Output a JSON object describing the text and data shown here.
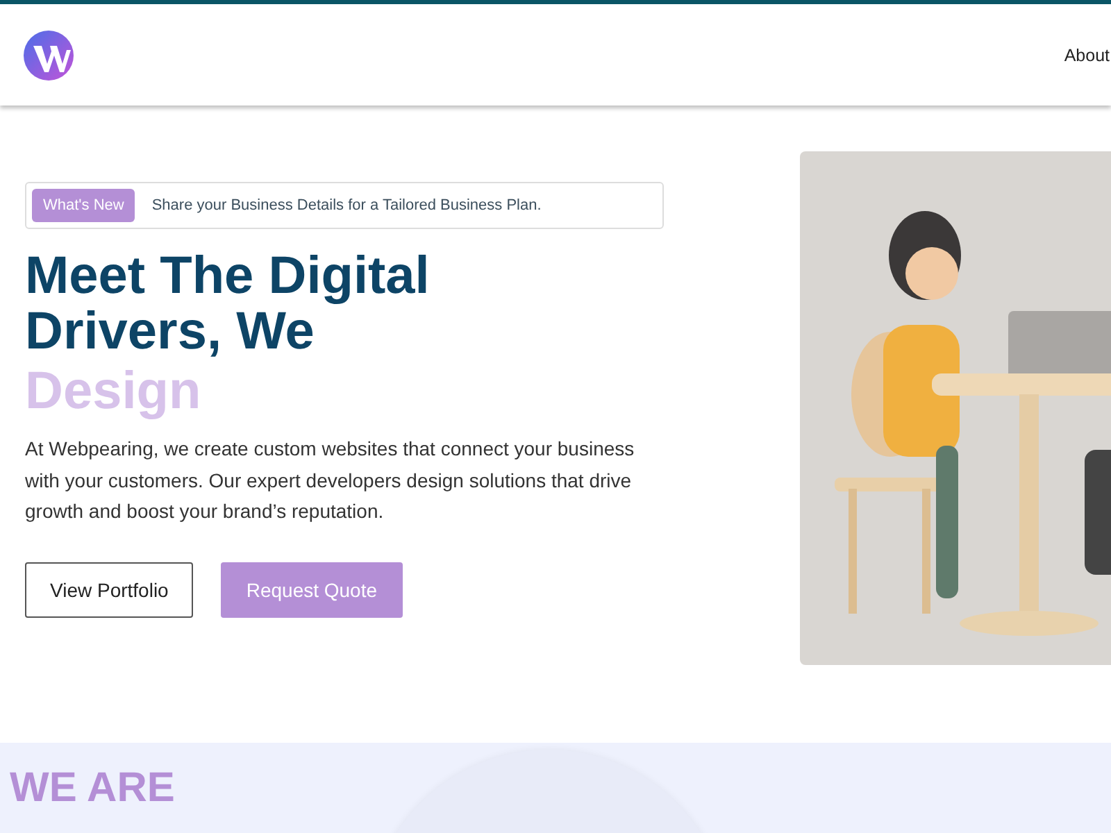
{
  "header": {
    "nav": [
      {
        "label": "About"
      }
    ]
  },
  "hero": {
    "badge": {
      "tag": "What's New",
      "text": "Share your Business Details for a Tailored Business Plan."
    },
    "title_lines": [
      "Meet The Digital",
      "Drivers, We"
    ],
    "title_accent": "Design",
    "description": "At Webpearing, we create custom websites that connect your business with your customers. Our expert developers design solutions that drive growth and boost your brand’s reputation.",
    "buttons": [
      {
        "label": "View Portfolio",
        "kind": "outline"
      },
      {
        "label": "Request Quote",
        "kind": "filled"
      }
    ]
  },
  "about": {
    "eyebrow": "WE ARE"
  }
}
